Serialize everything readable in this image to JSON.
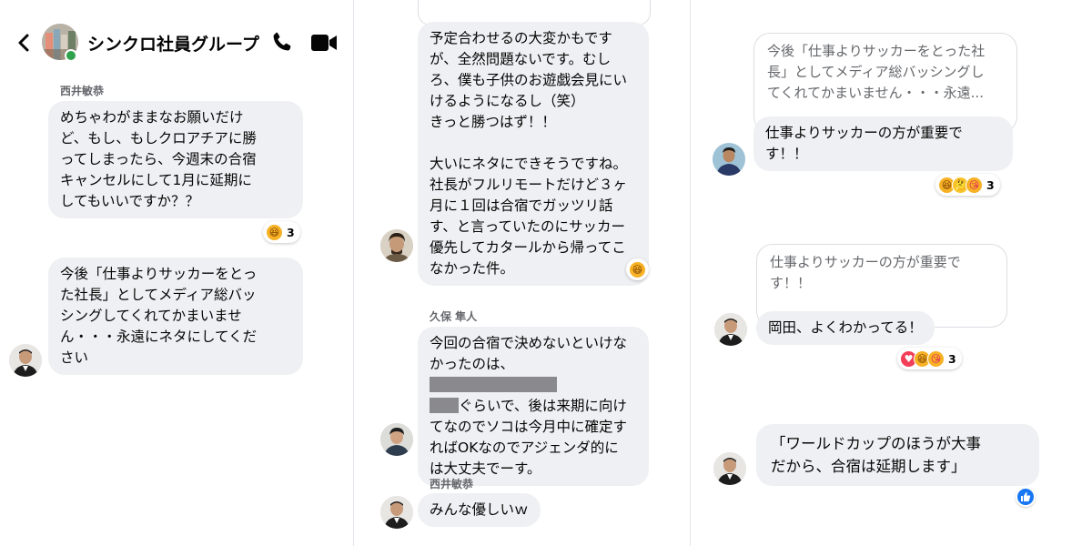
{
  "header": {
    "title": "シンクロ社員グループ"
  },
  "panel1": {
    "sender": "西井敏恭",
    "msg1": "めちゃわがままなお願いだけ\nど、もし、もしクロアチアに勝\nってしまったら、今週末の合宿\nキャンセルにして1月に延期に\nしてもいいですか？？",
    "msg1_reaction_count": "3",
    "msg2": "今後「仕事よりサッカーをとっ\nた社長」としてメディア総バッ\nシングしてくれてかまいませ\nん・・・永遠にネタにしてくだ\nさい"
  },
  "panel2": {
    "msg1": "予定合わせるの大変かもです\nが、全然問題ないです。むし\nろ、僕も子供のお遊戯会見にい\nけるようになるし（笑）\nきっと勝つはず！！\n\n大いにネタにできそうですね。\n社長がフルリモートだけど３ヶ\n月に１回は合宿でガッツリ話\nす、と言っていたのにサッカー\n優先してカタールから帰ってこ\nなかった件。",
    "sender2": "久保 隼人",
    "msg2_a": "今回の合宿で決めないといけな\nかったのは、",
    "msg2_b": "ぐらいで、後は来期に向け\nてなのでソコは今月中に確定す\nればOKなのでアジェンダ的に\nは大丈夫でーす。",
    "sender3": "西井敏恭",
    "msg3": "みんな優しいｗ"
  },
  "panel3": {
    "quote1": "今後「仕事よりサッカーをとった社\n長」としてメディア総バッシングし\nてくれてかまいません・・・永遠...",
    "reply1": "仕事よりサッカーの方が重要で\nす！！",
    "reply1_reaction_count": "3",
    "quote2": "仕事よりサッカーの方が重要で\nす！！",
    "reply2": "岡田、よくわかってる！",
    "reply2_reaction_count": "3",
    "msg3": "「ワールドカップのほうが大事\nだから、合宿は延期します」"
  },
  "icons": [
    "back-chevron-icon",
    "phone-icon",
    "video-camera-icon",
    "like-icon",
    "heart-icon",
    "laugh-icon",
    "thinking-icon",
    "kiss-icon"
  ],
  "colors": {
    "accent": "#050505",
    "bubble": "#eff0f3",
    "like": "#1877f2",
    "online": "#31a24c"
  }
}
